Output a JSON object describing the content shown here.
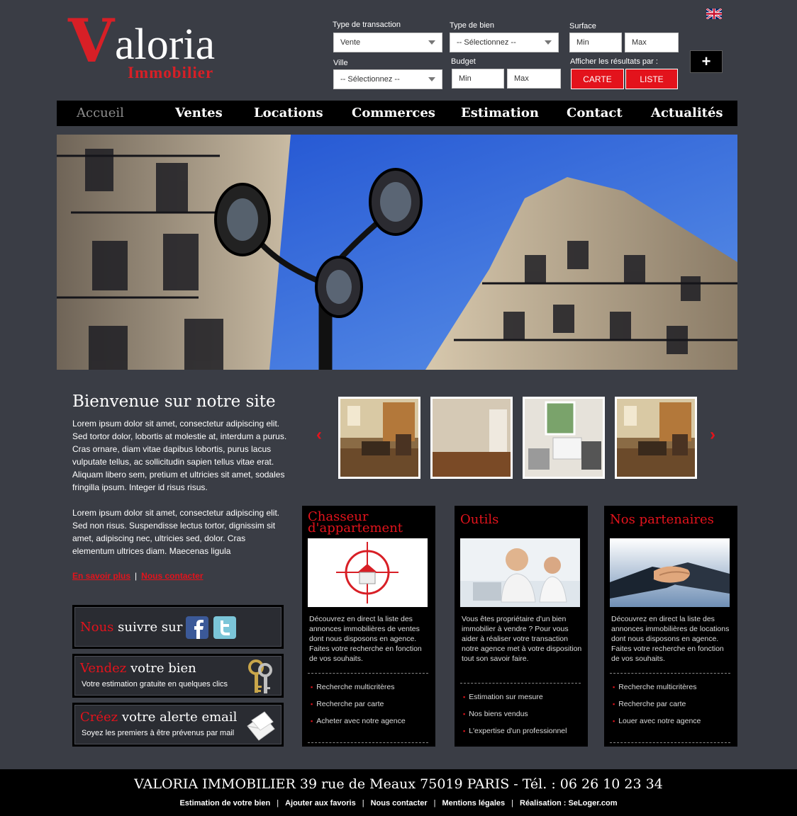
{
  "brand": {
    "logo_first_letter": "V",
    "logo_rest": "aloria",
    "logo_sub": "Immobilier"
  },
  "colors": {
    "accent": "#e3131c",
    "background": "#3a3d45",
    "nav": "#000000"
  },
  "search": {
    "transaction_label": "Type de transaction",
    "transaction_value": "Vente",
    "bien_label": "Type de bien",
    "bien_value": "-- Sélectionnez --",
    "surface_label": "Surface",
    "surface_min": "Min",
    "surface_max": "Max",
    "ville_label": "Ville",
    "ville_value": "-- Sélectionnez --",
    "budget_label": "Budget",
    "budget_min": "Min",
    "budget_max": "Max",
    "results_label": "Afficher les résultats par :",
    "carte_button": "CARTE",
    "liste_button": "LISTE",
    "more_button": "+"
  },
  "language_flag": "uk-flag-icon",
  "nav": {
    "items": [
      {
        "label": "Accueil"
      },
      {
        "label": "Ventes"
      },
      {
        "label": "Locations"
      },
      {
        "label": "Commerces"
      },
      {
        "label": "Estimation"
      },
      {
        "label": "Contact"
      },
      {
        "label": "Actualités"
      }
    ]
  },
  "welcome": {
    "title": "Bienvenue sur notre site",
    "para1": "Lorem ipsum dolor sit amet, consectetur adipiscing elit. Sed tortor dolor, lobortis at molestie at, interdum a purus. Cras ornare, diam vitae dapibus lobortis, purus lacus vulputate tellus, ac sollicitudin sapien tellus vitae erat. Aliquam libero sem, pretium et ultricies sit amet, sodales fringilla ipsum. Integer id risus risus.",
    "para2": "Lorem ipsum dolor sit amet, consectetur adipiscing elit. Sed non risus. Suspendisse lectus tortor, dignissim sit amet, adipiscing nec, ultricies sed, dolor. Cras elementum ultrices diam. Maecenas ligula",
    "link_more": "En savoir plus",
    "link_sep": "|",
    "link_contact": "Nous contacter"
  },
  "side": {
    "follow": {
      "red": "Nous",
      "rest": " suivre sur"
    },
    "sell": {
      "red": "Vendez",
      "rest": " votre bien",
      "sub": "Votre estimation gratuite en quelques clics"
    },
    "alert": {
      "red": "Créez",
      "rest": " votre alerte email",
      "sub": "Soyez les premiers à être prévenus par mail"
    }
  },
  "carousel": {
    "prev": "‹",
    "next": "›"
  },
  "columns": [
    {
      "title": "Chasseur d'appartement",
      "desc": "Découvrez en direct la liste des annonces immobilières de ventes dont nous disposons en agence. Faites votre recherche en fonction de vos souhaits.",
      "items": [
        "Recherche multicritères",
        "Recherche par carte",
        "Acheter avec notre agence"
      ]
    },
    {
      "title": "Outils",
      "desc": "Vous êtes propriétaire d'un bien immobilier à vendre ? Pour vous aider à réaliser votre transaction notre agence met à votre disposition tout son savoir faire.",
      "items": [
        "Estimation sur mesure",
        "Nos biens vendus",
        "L'expertise d'un professionnel"
      ]
    },
    {
      "title": "Nos partenaires",
      "desc": "Découvrez en direct la liste des annonces immobilières de locations dont nous disposons en agence. Faites votre recherche en fonction de vos souhaits.",
      "items": [
        "Recherche multicritères",
        "Recherche par carte",
        "Louer avec notre agence"
      ]
    }
  ],
  "footer": {
    "address": "VALORIA IMMOBILIER 39 rue de Meaux 75019 PARIS - Tél. : 06 26 10 23 34",
    "links": [
      "Estimation de votre bien",
      "Ajouter aux favoris",
      "Nous contacter",
      "Mentions légales",
      "Réalisation : SeLoger.com"
    ],
    "sep": "|"
  }
}
